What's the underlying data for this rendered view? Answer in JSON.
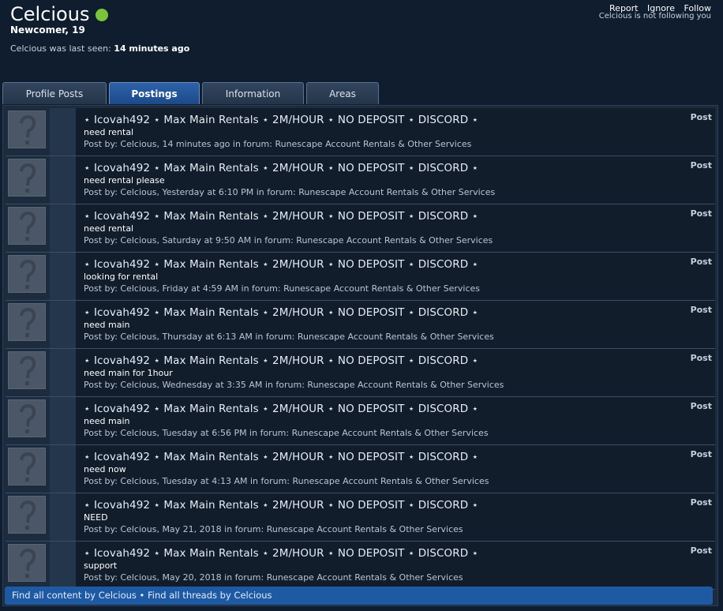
{
  "profile": {
    "username": "Celcious",
    "user_title": "Newcomer, 19",
    "last_seen_label": "Celcious was last seen:",
    "last_seen_value": "14 minutes ago",
    "status_color": "#7bc43a"
  },
  "actions": {
    "report": "Report",
    "ignore": "Ignore",
    "follow": "Follow",
    "follow_status": "Celcious is not following you"
  },
  "tabs": [
    {
      "label": "Profile Posts",
      "active": false
    },
    {
      "label": "Postings",
      "active": true
    },
    {
      "label": "Information",
      "active": false
    },
    {
      "label": "Areas",
      "active": false
    }
  ],
  "posts": [
    {
      "title": "⋆ Icovah492 ⋆ Max Main Rentals ⋆ 2M/HOUR ⋆ NO DEPOSIT ⋆ DISCORD ⋆",
      "snippet": "need rental",
      "meta": "Post by: Celcious, 14 minutes ago in forum: Runescape Account Rentals & Other Services",
      "type": "Post"
    },
    {
      "title": "⋆ Icovah492 ⋆ Max Main Rentals ⋆ 2M/HOUR ⋆ NO DEPOSIT ⋆ DISCORD ⋆",
      "snippet": "need rental please",
      "meta": "Post by: Celcious, Yesterday at 6:10 PM in forum: Runescape Account Rentals & Other Services",
      "type": "Post"
    },
    {
      "title": "⋆ Icovah492 ⋆ Max Main Rentals ⋆ 2M/HOUR ⋆ NO DEPOSIT ⋆ DISCORD ⋆",
      "snippet": "need rental",
      "meta": "Post by: Celcious, Saturday at 9:50 AM in forum: Runescape Account Rentals & Other Services",
      "type": "Post"
    },
    {
      "title": "⋆ Icovah492 ⋆ Max Main Rentals ⋆ 2M/HOUR ⋆ NO DEPOSIT ⋆ DISCORD ⋆",
      "snippet": "looking for rental",
      "meta": "Post by: Celcious, Friday at 4:59 AM in forum: Runescape Account Rentals & Other Services",
      "type": "Post"
    },
    {
      "title": "⋆ Icovah492 ⋆ Max Main Rentals ⋆ 2M/HOUR ⋆ NO DEPOSIT ⋆ DISCORD ⋆",
      "snippet": "need main",
      "meta": "Post by: Celcious, Thursday at 6:13 AM in forum: Runescape Account Rentals & Other Services",
      "type": "Post"
    },
    {
      "title": "⋆ Icovah492 ⋆ Max Main Rentals ⋆ 2M/HOUR ⋆ NO DEPOSIT ⋆ DISCORD ⋆",
      "snippet": "need main for 1hour",
      "meta": "Post by: Celcious, Wednesday at 3:35 AM in forum: Runescape Account Rentals & Other Services",
      "type": "Post"
    },
    {
      "title": "⋆ Icovah492 ⋆ Max Main Rentals ⋆ 2M/HOUR ⋆ NO DEPOSIT ⋆ DISCORD ⋆",
      "snippet": "need main",
      "meta": "Post by: Celcious, Tuesday at 6:56 PM in forum: Runescape Account Rentals & Other Services",
      "type": "Post"
    },
    {
      "title": "⋆ Icovah492 ⋆ Max Main Rentals ⋆ 2M/HOUR ⋆ NO DEPOSIT ⋆ DISCORD ⋆",
      "snippet": "need now",
      "meta": "Post by: Celcious, Tuesday at 4:13 AM in forum: Runescape Account Rentals & Other Services",
      "type": "Post"
    },
    {
      "title": "⋆ Icovah492 ⋆ Max Main Rentals ⋆ 2M/HOUR ⋆ NO DEPOSIT ⋆ DISCORD ⋆",
      "snippet": "NEED",
      "meta": "Post by: Celcious, May 21, 2018 in forum: Runescape Account Rentals & Other Services",
      "type": "Post"
    },
    {
      "title": "⋆ Icovah492 ⋆ Max Main Rentals ⋆ 2M/HOUR ⋆ NO DEPOSIT ⋆ DISCORD ⋆",
      "snippet": "support",
      "meta": "Post by: Celcious, May 20, 2018 in forum: Runescape Account Rentals & Other Services",
      "type": "Post"
    }
  ],
  "footer": {
    "all_content": "Find all content by Celcious",
    "separator": "•",
    "all_threads": "Find all threads by Celcious"
  }
}
